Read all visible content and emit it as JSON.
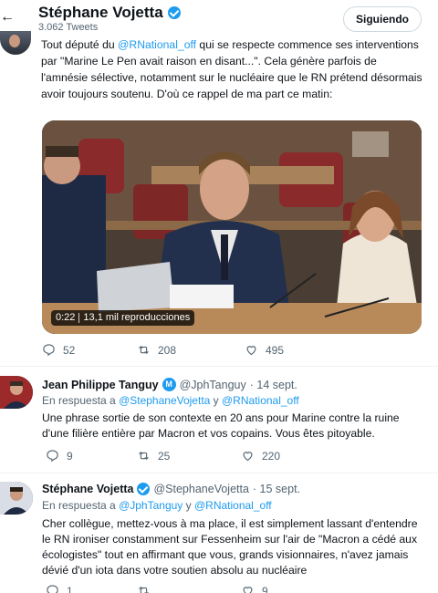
{
  "header": {
    "back_icon": "arrow-left-icon",
    "profile_name": "Stéphane Vojetta",
    "tweet_count": "3.062 Tweets",
    "follow_label": "Siguiendo"
  },
  "main_tweet": {
    "text_parts": [
      "Tout député du ",
      "@RNational_off",
      " qui se respecte commence ses interventions par \"Marine Le Pen avait raison en disant...\". Cela génère parfois de l'amnésie sélective, notamment sur le nucléaire que le RN prétend désormais avoir toujours soutenu. D'où ce rappel de ma part ce matin:"
    ],
    "video": {
      "duration": "0:22",
      "views": "13,1 mil reproducciones"
    },
    "stats": {
      "replies": "52",
      "retweets": "208",
      "likes": "495"
    }
  },
  "replies": [
    {
      "name": "Jean Philippe Tanguy",
      "badge": "M",
      "handle": "@JphTanguy",
      "date": "· 14 sept.",
      "reply_prefix": "En respuesta a ",
      "reply_user1": "@StephaneVojetta",
      "reply_and": " y ",
      "reply_user2": "@RNational_off",
      "text": "Une phrase sortie de son contexte en 20 ans pour Marine contre la ruine d'une filière entière par Macron et vos copains. Vous êtes pitoyable.",
      "stats": {
        "replies": "9",
        "retweets": "25",
        "likes": "220"
      }
    },
    {
      "name": "Stéphane Vojetta",
      "handle": "@StephaneVojetta",
      "date": "· 15 sept.",
      "reply_prefix": "En respuesta a ",
      "reply_user1": "@JphTanguy",
      "reply_and": " y ",
      "reply_user2": "@RNational_off",
      "text": "Cher collègue, mettez-vous à ma place, il est simplement lassant d'entendre le RN ironiser constamment sur Fessenheim sur l'air de \"Macron a cédé aux écologistes\" tout en affirmant que vous, grands visionnaires, n'avez jamais dévié d'un iota dans votre soutien absolu au nucléaire",
      "stats": {
        "replies": "1",
        "retweets": "",
        "likes": "9"
      }
    }
  ],
  "colors": {
    "accent": "#1d9bf0",
    "muted": "#536471",
    "text": "#0f1419"
  }
}
